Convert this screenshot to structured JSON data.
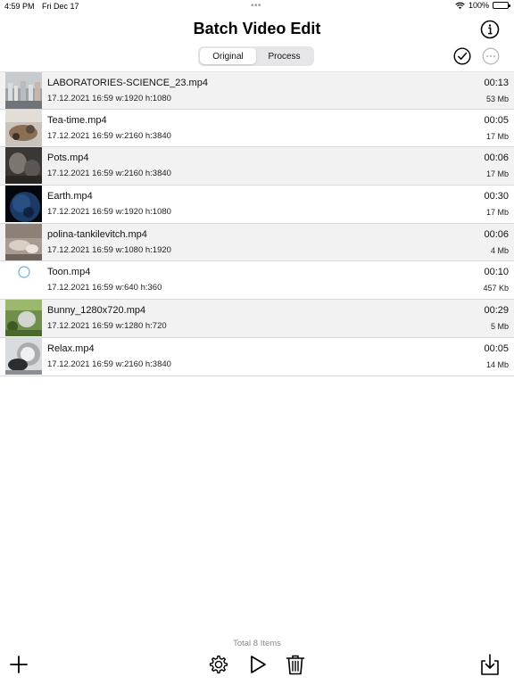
{
  "status_bar": {
    "time": "4:59 PM",
    "date": "Fri Dec 17",
    "battery": "100%",
    "dots": "•••"
  },
  "header": {
    "title": "Batch Video Edit",
    "tabs": [
      {
        "label": "Original",
        "active": true
      },
      {
        "label": "Process",
        "active": false
      }
    ]
  },
  "icons": {
    "info": "info-icon",
    "select": "checkmark-circle-icon",
    "more": "ellipsis-circle-icon",
    "add": "plus-icon",
    "settings": "gear-icon",
    "play": "play-icon",
    "trash": "trash-icon",
    "export": "download-icon"
  },
  "items": [
    {
      "name": "LABORATORIES-SCIENCE_23.mp4",
      "meta": "17.12.2021 16:59 w:1920 h:1080",
      "duration": "00:13",
      "size": "53 Mb",
      "thumb": "lab"
    },
    {
      "name": "Tea-time.mp4",
      "meta": "17.12.2021 16:59 w:2160 h:3840",
      "duration": "00:05",
      "size": "17 Mb",
      "thumb": "tea"
    },
    {
      "name": "Pots.mp4",
      "meta": "17.12.2021 16:59 w:2160 h:3840",
      "duration": "00:06",
      "size": "17 Mb",
      "thumb": "pots"
    },
    {
      "name": "Earth.mp4",
      "meta": "17.12.2021 16:59 w:1920 h:1080",
      "duration": "00:30",
      "size": "17 Mb",
      "thumb": "earth"
    },
    {
      "name": "polina-tankilevitch.mp4",
      "meta": "17.12.2021 16:59 w:1080 h:1920",
      "duration": "00:06",
      "size": "4 Mb",
      "thumb": "polina"
    },
    {
      "name": "Toon.mp4",
      "meta": "17.12.2021 16:59 w:640 h:360",
      "duration": "00:10",
      "size": "457 Kb",
      "thumb": "loading"
    },
    {
      "name": "Bunny_1280x720.mp4",
      "meta": "17.12.2021 16:59 w:1280 h:720",
      "duration": "00:29",
      "size": "5 Mb",
      "thumb": "bunny"
    },
    {
      "name": "Relax.mp4",
      "meta": "17.12.2021 16:59 w:2160 h:3840",
      "duration": "00:05",
      "size": "14 Mb",
      "thumb": "relax"
    }
  ],
  "footer": {
    "total": "Total 8 Items"
  },
  "colors": {
    "accent": "#000000",
    "alt_row": "#f2f2f2",
    "loading_ring": "#6ab0d8",
    "muted_text": "#8a8a8a"
  }
}
